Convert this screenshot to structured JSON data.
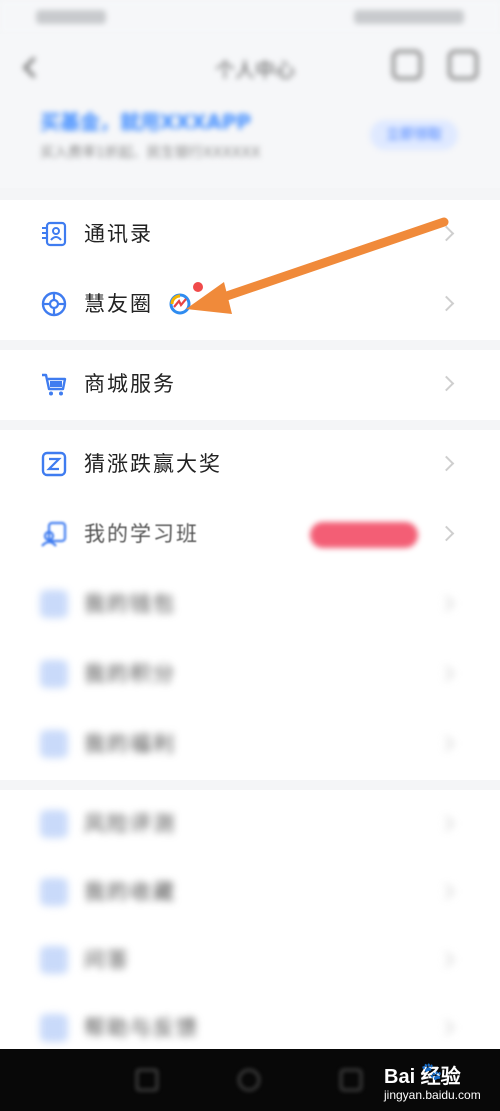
{
  "topbar": {
    "title": "个人中心"
  },
  "banner": {
    "title": "买基金，就用XXXAPP",
    "subtitle": "买入费率1折起、民生银行XXXXXX",
    "button_label": "立即领取"
  },
  "menu": {
    "contacts": {
      "label": "通讯录",
      "icon": "contacts-icon"
    },
    "moments": {
      "label": "慧友圈",
      "icon": "moments-icon",
      "has_new_dot": true
    },
    "mall": {
      "label": "商城服务",
      "icon": "cart-icon"
    },
    "guess": {
      "label": "猜涨跌赢大奖",
      "icon": "guess-icon"
    },
    "study": {
      "label": "我的学习班",
      "icon": "study-icon",
      "tag": ""
    },
    "blurred_items": [
      {
        "label": "我的钱包"
      },
      {
        "label": "我的积分"
      },
      {
        "label": "我的福利"
      },
      {
        "label": "风险评测"
      },
      {
        "label": "我的收藏"
      },
      {
        "label": "问答"
      },
      {
        "label": "帮助与反馈"
      }
    ]
  },
  "colors": {
    "accent": "#3f8cff",
    "annotation_arrow": "#f08a3a",
    "badge_red": "#f04a4a"
  },
  "watermark": {
    "logo": "Bai  经验",
    "site": "jingyan.baidu.com"
  }
}
